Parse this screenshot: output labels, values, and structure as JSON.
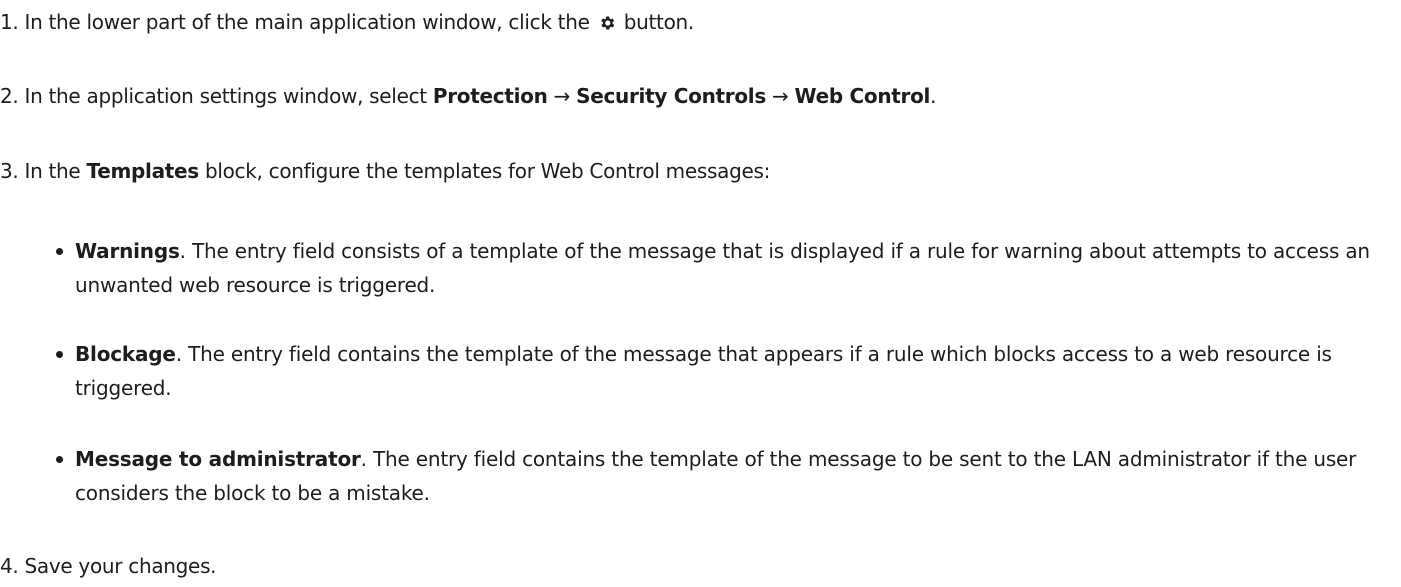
{
  "steps": {
    "s1": {
      "num": "1.",
      "before_icon": "In the lower part of the main application window, click the",
      "icon": "gear-icon",
      "after_icon": "button."
    },
    "s2": {
      "num": "2.",
      "text": "In the application settings window, select",
      "path1": "Protection",
      "arrow": "→",
      "path2": "Security Controls",
      "path3": "Web Control",
      "end": "."
    },
    "s3": {
      "num": "3.",
      "before": "In the",
      "term": "Templates",
      "after": "block, configure the templates for Web Control messages:"
    },
    "s4": {
      "num": "4.",
      "text": "Save your changes."
    }
  },
  "bullets": [
    {
      "term": "Warnings",
      "text": ". The entry field consists of a template of the message that is displayed if a rule for warning about attempts to access an unwanted web resource is triggered."
    },
    {
      "term": "Blockage",
      "text": ". The entry field contains the template of the message that appears if a rule which blocks access to a web resource is triggered."
    },
    {
      "term": "Message to administrator",
      "text": ". The entry field contains the template of the message to be sent to the LAN administrator if the user considers the block to be a mistake."
    }
  ],
  "colors": {
    "text": "#1d1d1b",
    "background": "#ffffff"
  }
}
